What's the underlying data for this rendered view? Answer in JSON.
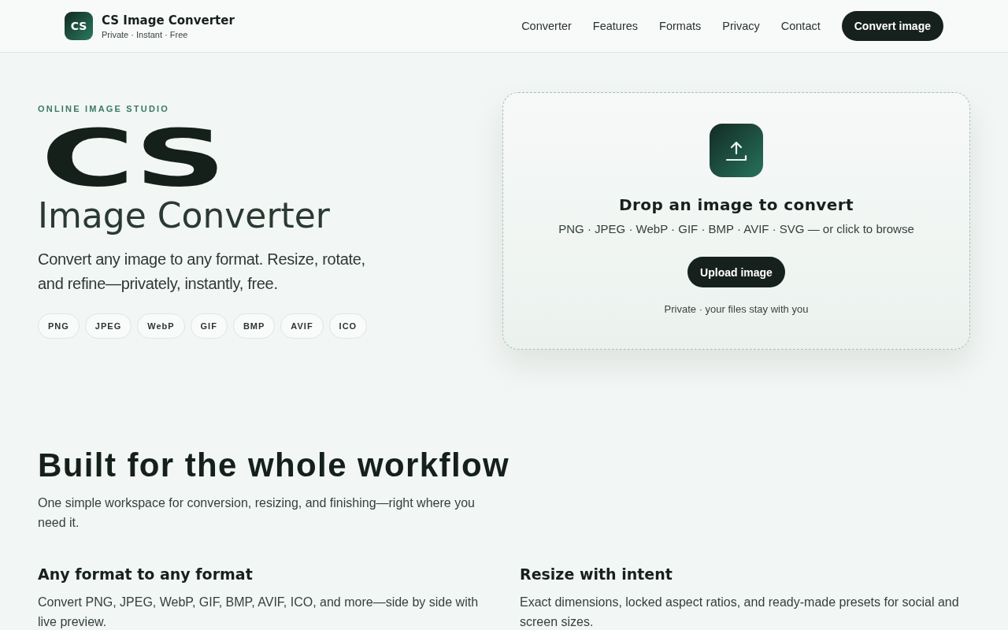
{
  "header": {
    "brand": {
      "logo_text": "CS",
      "title": "CS Image Converter",
      "tagline": "Private · Instant · Free"
    },
    "nav": [
      {
        "label": "Converter"
      },
      {
        "label": "Features"
      },
      {
        "label": "Formats"
      },
      {
        "label": "Privacy"
      },
      {
        "label": "Contact"
      }
    ],
    "cta": "Convert image"
  },
  "hero": {
    "eyebrow": "ONLINE IMAGE STUDIO",
    "title_mark": "CS",
    "title": "Image Converter",
    "lead": "Convert any image to any format. Resize, rotate, and refine—privately, instantly, free.",
    "formats": [
      "PNG",
      "JPEG",
      "WebP",
      "GIF",
      "BMP",
      "AVIF",
      "ICO"
    ]
  },
  "dropzone": {
    "title": "Drop an image to convert",
    "formats_line": "PNG · JPEG · WebP · GIF · BMP · AVIF · SVG — or click to browse",
    "button": "Upload image",
    "note": "Private · your files stay with you"
  },
  "features_section": {
    "title": "Built for the whole workflow",
    "lead": "One simple workspace for conversion, resizing, and finishing—right where you need it.",
    "features": [
      {
        "title": "Any format to any format",
        "text": "Convert PNG, JPEG, WebP, GIF, BMP, AVIF, ICO, and more—side by side with live preview."
      },
      {
        "title": "Resize with intent",
        "text": "Exact dimensions, locked aspect ratios, and ready-made presets for social and screen sizes."
      }
    ]
  }
}
